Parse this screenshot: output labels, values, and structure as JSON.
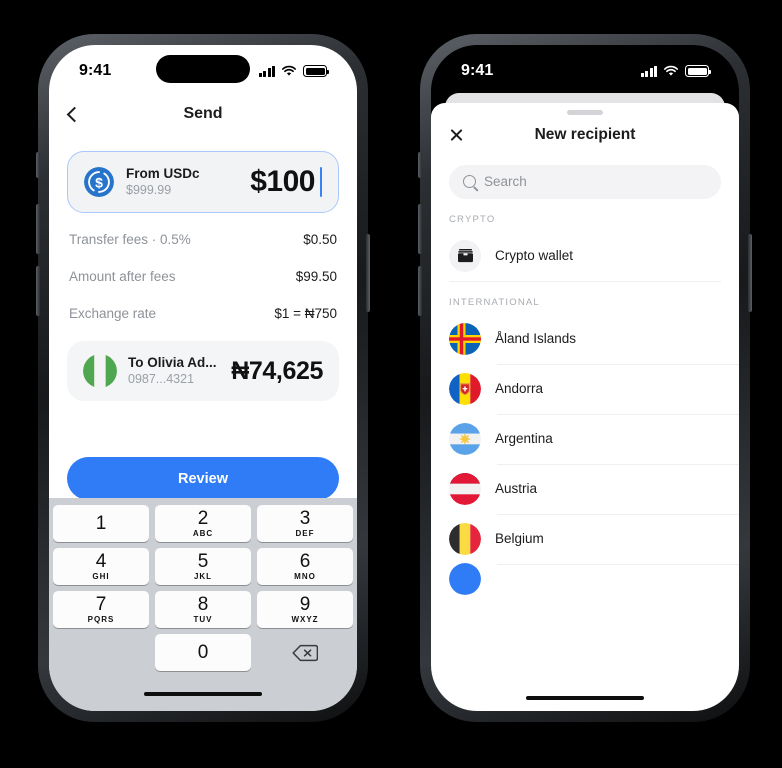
{
  "send_screen": {
    "status_bar": {
      "time": "9:41",
      "signal_icon": "cellular-bars-icon",
      "wifi_icon": "wifi-icon",
      "battery_icon": "battery-icon"
    },
    "nav": {
      "back_icon": "chevron-left-icon",
      "title": "Send"
    },
    "amount_card": {
      "token_icon": "usdc-coin-icon",
      "source_label": "From USDc",
      "balance": "$999.99",
      "amount": "$100"
    },
    "fees": [
      {
        "label": "Transfer fees · 0.5%",
        "value": "$0.50"
      },
      {
        "label": "Amount after fees",
        "value": "$99.50"
      },
      {
        "label": "Exchange rate",
        "value": "$1 = ₦750"
      }
    ],
    "recipient_card": {
      "flag_icon": "nigeria-flag-icon",
      "name": "To Olivia Ad...",
      "account": "0987...4321",
      "amount": "₦74,625"
    },
    "review_button": "Review",
    "keypad": {
      "keys": [
        {
          "num": "1",
          "sub": ""
        },
        {
          "num": "2",
          "sub": "ABC"
        },
        {
          "num": "3",
          "sub": "DEF"
        },
        {
          "num": "4",
          "sub": "GHI"
        },
        {
          "num": "5",
          "sub": "JKL"
        },
        {
          "num": "6",
          "sub": "MNO"
        },
        {
          "num": "7",
          "sub": "PQRS"
        },
        {
          "num": "8",
          "sub": "TUV"
        },
        {
          "num": "9",
          "sub": "WXYZ"
        },
        {
          "num": "0",
          "sub": ""
        }
      ],
      "delete_icon": "delete-backspace-icon"
    }
  },
  "recipient_screen": {
    "status_bar": {
      "time": "9:41",
      "signal_icon": "cellular-bars-icon",
      "wifi_icon": "wifi-icon",
      "battery_icon": "battery-icon"
    },
    "sheet": {
      "grabber_icon": "sheet-grabber-icon",
      "close_icon": "close-x-icon",
      "title": "New recipient",
      "search": {
        "icon": "search-icon",
        "placeholder": "Search",
        "value": ""
      },
      "sections": [
        {
          "heading": "CRYPTO",
          "items": [
            {
              "label": "Crypto wallet",
              "icon": "wallet-icon"
            }
          ]
        },
        {
          "heading": "INTERNATIONAL",
          "items": [
            {
              "label": "Åland Islands",
              "icon": "aland-islands-flag-icon"
            },
            {
              "label": "Andorra",
              "icon": "andorra-flag-icon"
            },
            {
              "label": "Argentina",
              "icon": "argentina-flag-icon"
            },
            {
              "label": "Austria",
              "icon": "austria-flag-icon"
            },
            {
              "label": "Belgium",
              "icon": "belgium-flag-icon"
            }
          ]
        }
      ]
    }
  },
  "colors": {
    "accent_blue": "#2f7cf6",
    "usdc_blue": "#2775ca",
    "card_grey": "#f2f3f5",
    "keypad_grey": "#cbced2",
    "muted_text": "#8e9298"
  }
}
